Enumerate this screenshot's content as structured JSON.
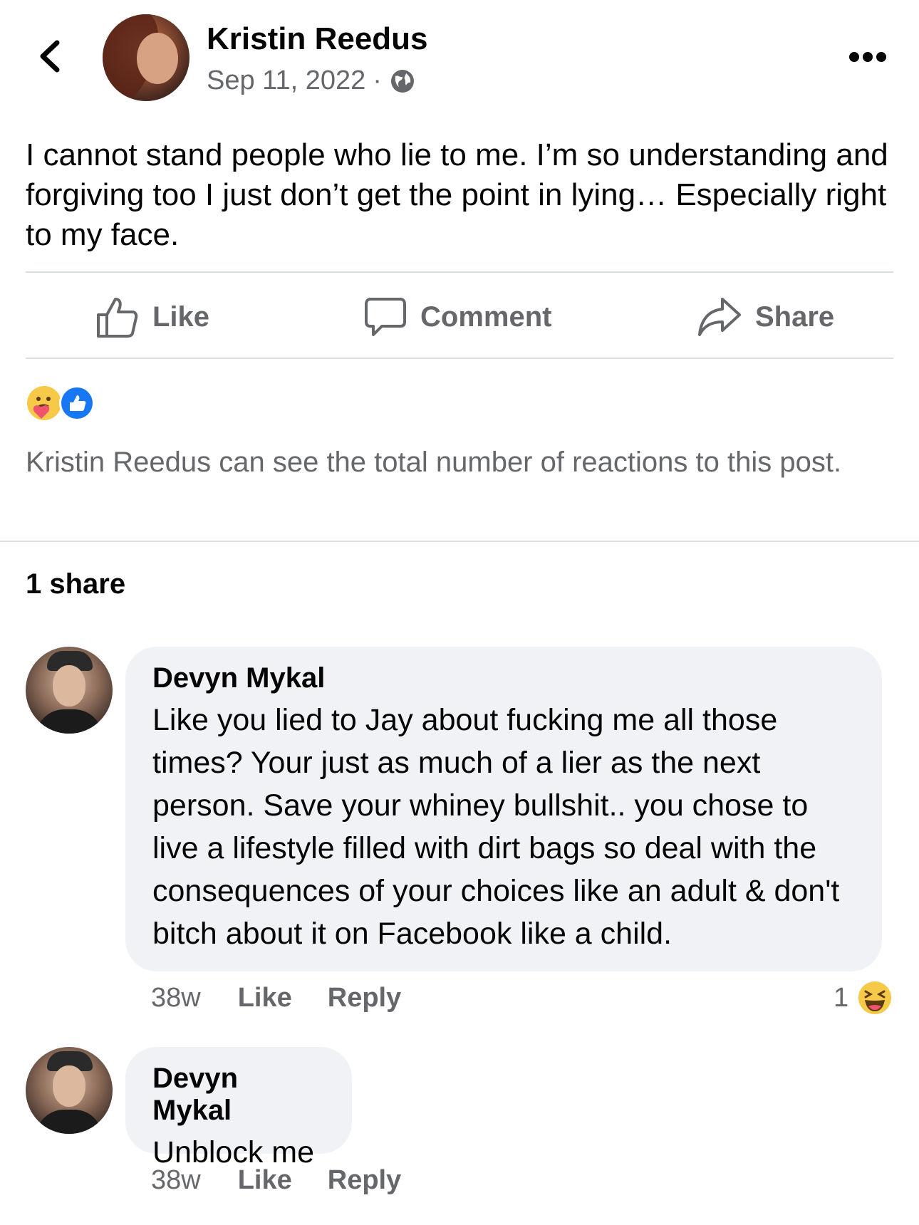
{
  "post": {
    "author": "Kristin Reedus",
    "date": "Sep 11, 2022",
    "separator": "·",
    "privacy_icon": "globe-icon",
    "text": "I cannot stand people who lie to me. I’m so understanding and forgiving too I just don’t get the point in lying… Especially right to my face."
  },
  "actions": {
    "like_label": "Like",
    "comment_label": "Comment",
    "share_label": "Share"
  },
  "reactions": {
    "icons": [
      "care-reaction-icon",
      "like-reaction-icon"
    ],
    "notice": "Kristin Reedus can see the total number of reactions to this post."
  },
  "shares_count": "1 share",
  "comments": [
    {
      "author": "Devyn Mykal",
      "text": "Like you lied to Jay about fucking me all those times? Your just as much of a lier as the next person. Save your whiney bullshit.. you chose to live a lifestyle filled with dirt bags so deal with the consequences of your choices like an adult & don't bitch about it on Facebook like a child.",
      "time": "38w",
      "like_label": "Like",
      "reply_label": "Reply",
      "reaction_count": "1",
      "reaction_icon": "haha-reaction-icon"
    },
    {
      "author": "Devyn Mykal",
      "text": "Unblock me",
      "time": "38w",
      "like_label": "Like",
      "reply_label": "Reply"
    }
  ],
  "colors": {
    "text": "#050505",
    "secondary": "#65676b",
    "bubble": "#f0f2f5",
    "divider": "#dadde1",
    "like_blue": "#1877f2"
  }
}
